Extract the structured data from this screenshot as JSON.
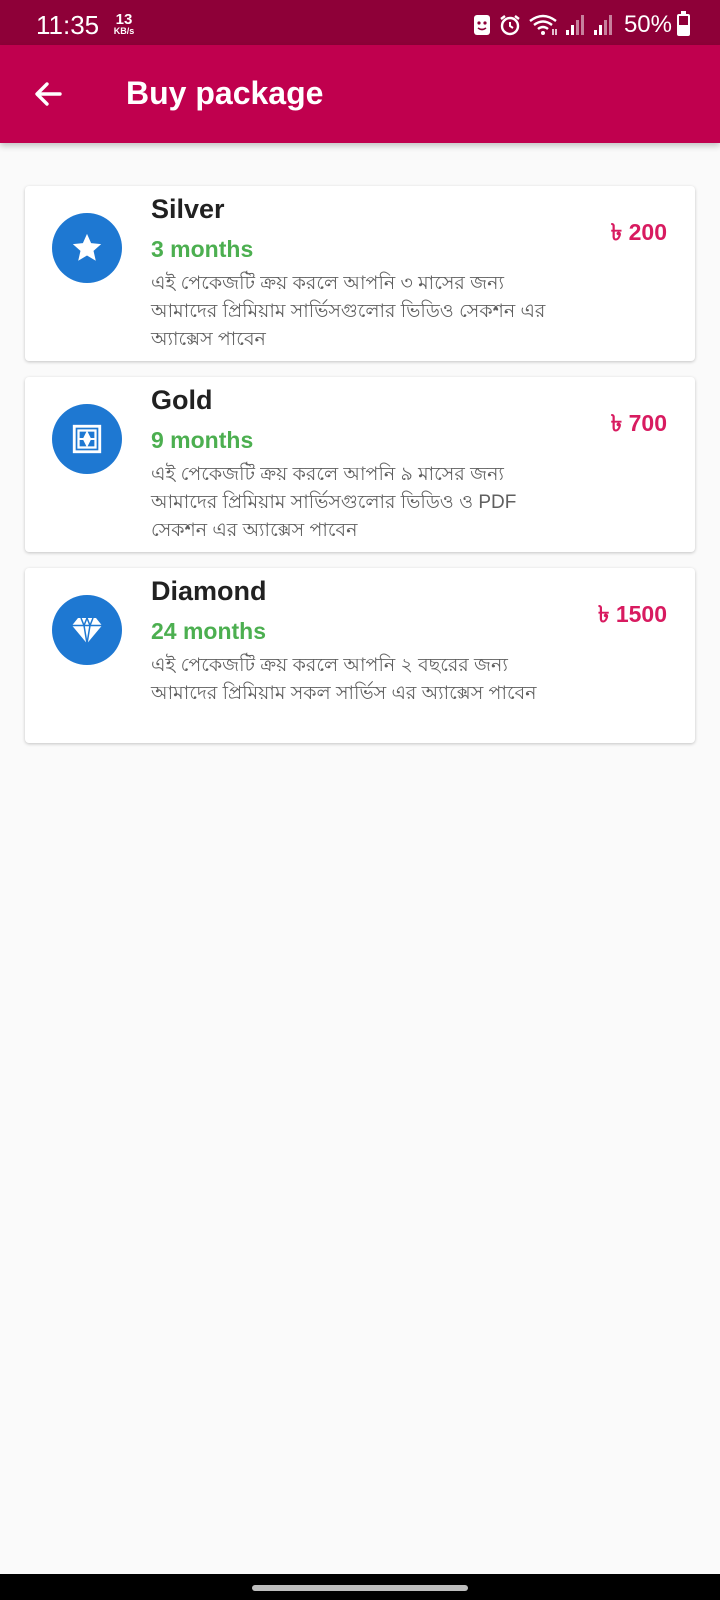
{
  "status_bar": {
    "time": "11:35",
    "net_speed_value": "13",
    "net_speed_unit": "KB/s",
    "battery": "50%",
    "icons": [
      "face-lock-icon",
      "alarm-icon",
      "wifi-icon",
      "signal-icon",
      "signal-icon",
      "battery-icon"
    ]
  },
  "app_bar": {
    "title": "Buy package",
    "back_icon": "arrow-left-icon"
  },
  "packages": [
    {
      "name": "Silver",
      "duration": "3 months",
      "description": "এই পেকেজটি ক্রয় করলে আপনি ৩ মাসের জন্য আমাদের প্রিমিয়াম সার্ভিসগুলোর ভিডিও সেকশন এর অ্যাক্সেস পাবেন",
      "price": "৳ 200",
      "icon": "star-icon"
    },
    {
      "name": "Gold",
      "duration": "9 months",
      "description": "এই পেকেজটি ক্রয় করলে আপনি ৯ মাসের জন্য আমাদের প্রিমিয়াম সার্ভিসগুলোর ভিডিও ও PDF সেকশন এর অ্যাক্সেস পাবেন",
      "price": "৳ 700",
      "icon": "gold-frame-icon"
    },
    {
      "name": "Diamond",
      "duration": "24 months",
      "description": "এই পেকেজটি ক্রয় করলে আপনি ২ বছরের জন্য আমাদের প্রিমিয়াম সকল সার্ভিস এর অ্যাক্সেস পাবেন",
      "price": "৳ 1500",
      "icon": "diamond-icon"
    }
  ],
  "colors": {
    "status_bar": "#8e0038",
    "app_bar": "#c0004e",
    "icon_circle": "#1e78d2",
    "duration": "#4caf50",
    "price": "#d81b60"
  }
}
